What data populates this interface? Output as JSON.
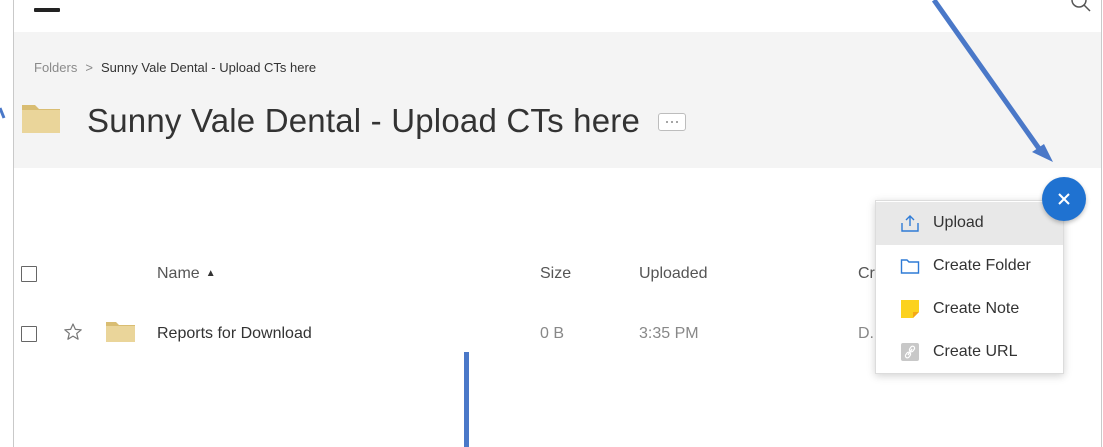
{
  "breadcrumb": {
    "root": "Folders",
    "separator": ">",
    "current": "Sunny Vale Dental - Upload CTs here"
  },
  "page_title": "Sunny Vale Dental - Upload CTs here",
  "table": {
    "columns": {
      "name": "Name",
      "size": "Size",
      "uploaded": "Uploaded",
      "created_partial": "Cr"
    },
    "sort_indicator": "▲",
    "rows": [
      {
        "name": "Reports for Download",
        "size": "0 B",
        "uploaded": "3:35 PM",
        "created_partial": "D."
      }
    ]
  },
  "add_menu": {
    "items": [
      {
        "label": "Upload",
        "icon": "upload-icon",
        "active": true
      },
      {
        "label": "Create Folder",
        "icon": "folder-outline-icon"
      },
      {
        "label": "Create Note",
        "icon": "note-icon"
      },
      {
        "label": "Create URL",
        "icon": "link-icon"
      }
    ]
  },
  "colors": {
    "accent": "#1f72d1",
    "annotation": "#4a78c8",
    "folder": "#e7cf8e",
    "note": "#fcd21e"
  }
}
